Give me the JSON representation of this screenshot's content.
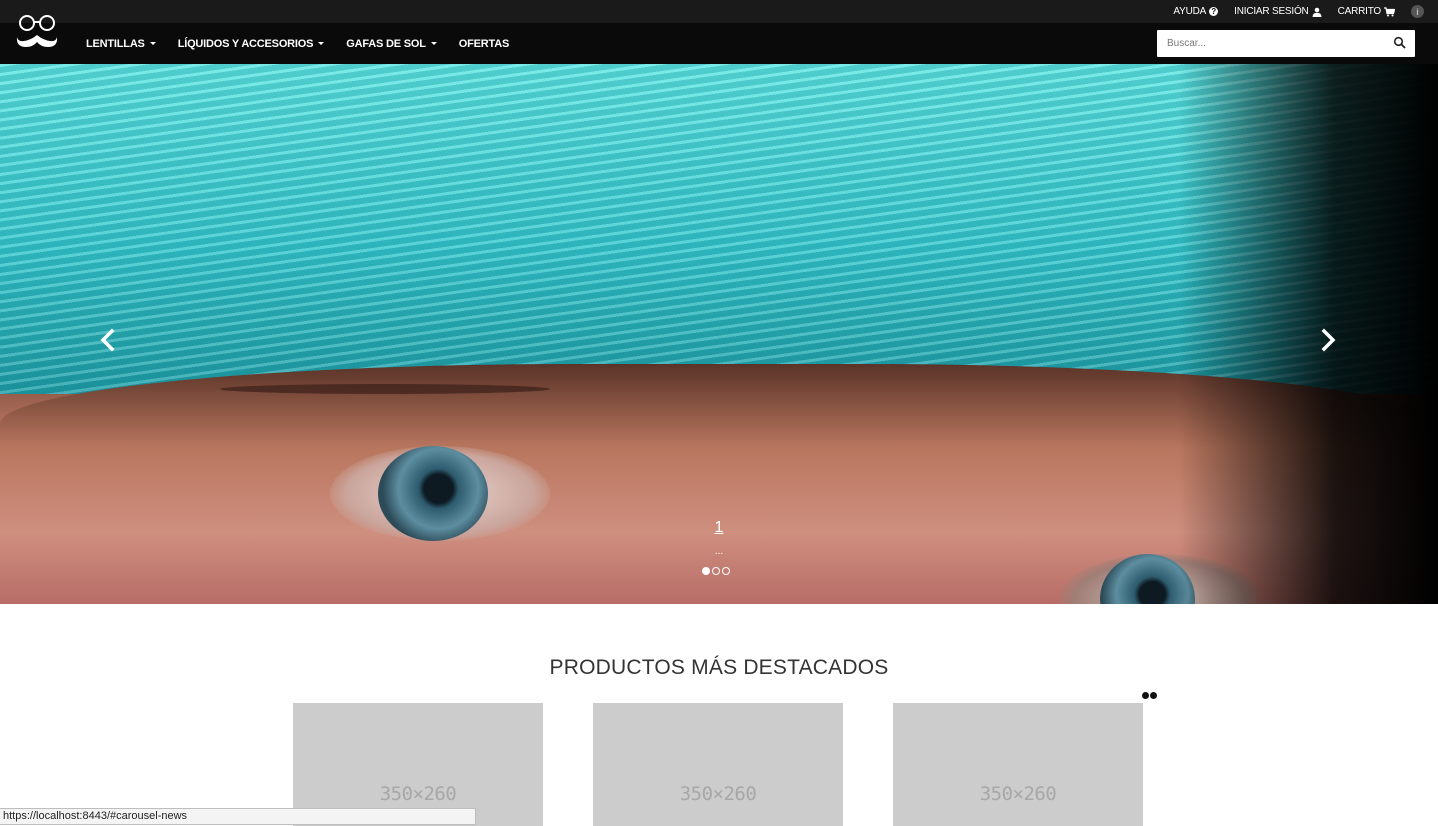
{
  "topbar": {
    "help_label": "AYUDA",
    "login_label": "INICIAR SESIÓN",
    "cart_label": "CARRITO",
    "info_icon": "i"
  },
  "navbar": {
    "logo": "glasses-mustache-logo",
    "items": [
      {
        "label": "LENTILLAS",
        "has_dropdown": true
      },
      {
        "label": "LÍQUIDOS Y ACCESORIOS",
        "has_dropdown": true
      },
      {
        "label": "GAFAS DE SOL",
        "has_dropdown": true
      },
      {
        "label": "OFERTAS",
        "has_dropdown": false
      }
    ],
    "search": {
      "placeholder": "Buscar...",
      "value": ""
    }
  },
  "hero": {
    "caption_title": "1",
    "caption_text": "...",
    "indicators": 3,
    "active_index": 0
  },
  "products": {
    "title": "PRODUCTOS MÁS DESTACADOS",
    "items": [
      {
        "placeholder": "350×260"
      },
      {
        "placeholder": "350×260"
      },
      {
        "placeholder": "350×260"
      }
    ]
  },
  "status_bar": {
    "url": "https://localhost:8443/#carousel-news"
  },
  "colors": {
    "topbar_bg": "#1a1a1a",
    "navbar_bg": "#0a0a0a",
    "placeholder_bg": "#cccccc"
  }
}
